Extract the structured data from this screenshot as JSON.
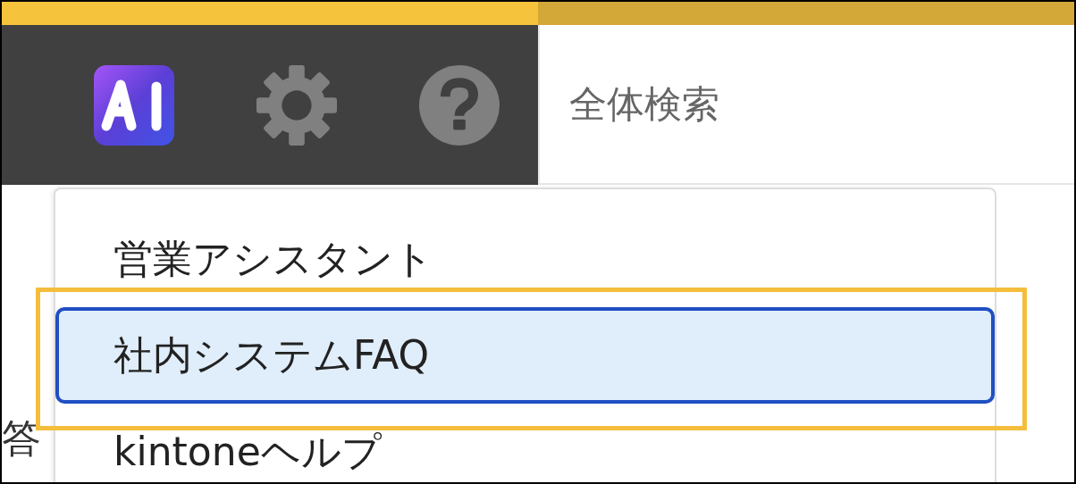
{
  "toolbar": {
    "icons": [
      {
        "kind": "ai"
      },
      {
        "kind": "settings"
      },
      {
        "kind": "help"
      }
    ]
  },
  "search": {
    "placeholder": "全体検索"
  },
  "background_text": "答",
  "menu": {
    "items": [
      {
        "label": "営業アシスタント",
        "selected": false,
        "highlighted": false
      },
      {
        "label": "社内システムFAQ",
        "selected": true,
        "highlighted": true
      },
      {
        "label": "kintoneヘルプ",
        "selected": false,
        "highlighted": false
      }
    ]
  }
}
